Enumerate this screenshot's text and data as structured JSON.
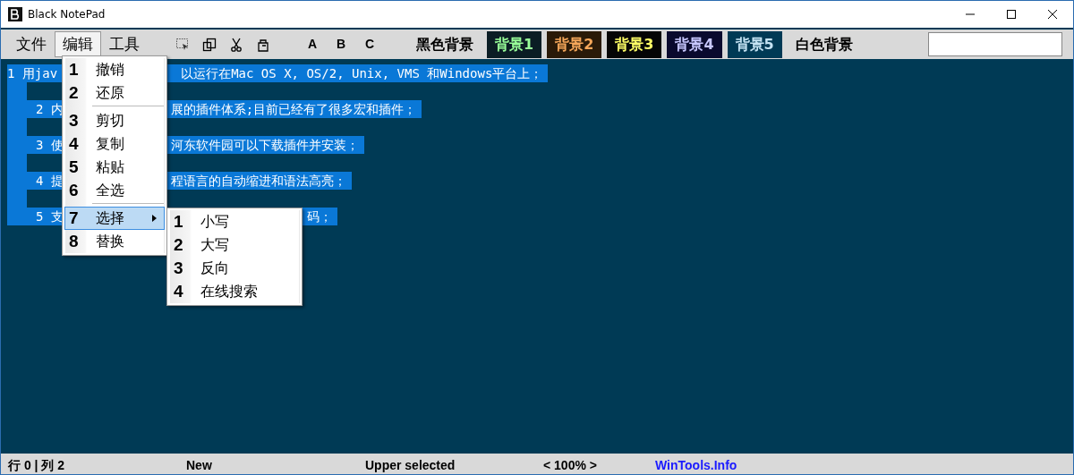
{
  "window": {
    "title": "Black NotePad"
  },
  "menubar": [
    {
      "label": "文件",
      "selected": false
    },
    {
      "label": "编辑",
      "selected": true
    },
    {
      "label": "工具",
      "selected": false
    }
  ],
  "font_buttons": [
    "A",
    "B",
    "C"
  ],
  "themes": [
    {
      "label": "黑色背景",
      "kind": "plain"
    },
    {
      "label": "背景1",
      "kind": "swatch",
      "color": "#0b1d24"
    },
    {
      "label": "背景2",
      "kind": "swatch",
      "color": "#2a1a08"
    },
    {
      "label": "背景3",
      "kind": "swatch",
      "color": "#050505"
    },
    {
      "label": "背景4",
      "kind": "swatch",
      "color": "#0a0a2e"
    },
    {
      "label": "背景5",
      "kind": "swatch",
      "color": "#003a55"
    },
    {
      "label": "白色背景",
      "kind": "plain"
    }
  ],
  "editor_lines": [
    {
      "start": "1 用jav",
      "end": "以运行在Mac OS X, OS/2, Unix, VMS 和Windows平台上；"
    },
    {
      "start": "2 内",
      "end": "展的插件体系;目前已经有了很多宏和插件；"
    },
    {
      "start": "3 使",
      "end": "河东软件园可以下载插件并安装；"
    },
    {
      "start": "4 提",
      "end": "程语言的自动缩进和语法高亮；"
    },
    {
      "start": "5 支",
      "end": "码；"
    }
  ],
  "edit_menu": [
    {
      "number": "1",
      "label": "撤销",
      "selected": false,
      "separator_after": false,
      "submenu": false
    },
    {
      "number": "2",
      "label": "还原",
      "selected": false,
      "separator_after": true,
      "submenu": false
    },
    {
      "number": "3",
      "label": "剪切",
      "selected": false,
      "separator_after": false,
      "submenu": false
    },
    {
      "number": "4",
      "label": "复制",
      "selected": false,
      "separator_after": false,
      "submenu": false
    },
    {
      "number": "5",
      "label": "粘贴",
      "selected": false,
      "separator_after": false,
      "submenu": false
    },
    {
      "number": "6",
      "label": "全选",
      "selected": false,
      "separator_after": true,
      "submenu": false
    },
    {
      "number": "7",
      "label": "选择",
      "selected": true,
      "separator_after": false,
      "submenu": true
    },
    {
      "number": "8",
      "label": "替换",
      "selected": false,
      "separator_after": false,
      "submenu": false
    }
  ],
  "select_submenu": [
    {
      "number": "1",
      "label": "小写",
      "selected": false
    },
    {
      "number": "2",
      "label": "大写",
      "selected": false
    },
    {
      "number": "3",
      "label": "反向",
      "selected": false
    },
    {
      "number": "4",
      "label": "在线搜索",
      "selected": false
    }
  ],
  "status_bar": {
    "position": "行 0 | 列 2",
    "file_state": "New",
    "message": "Upper selected",
    "zoom": "< 100% >",
    "link": "WinTools.Info"
  }
}
